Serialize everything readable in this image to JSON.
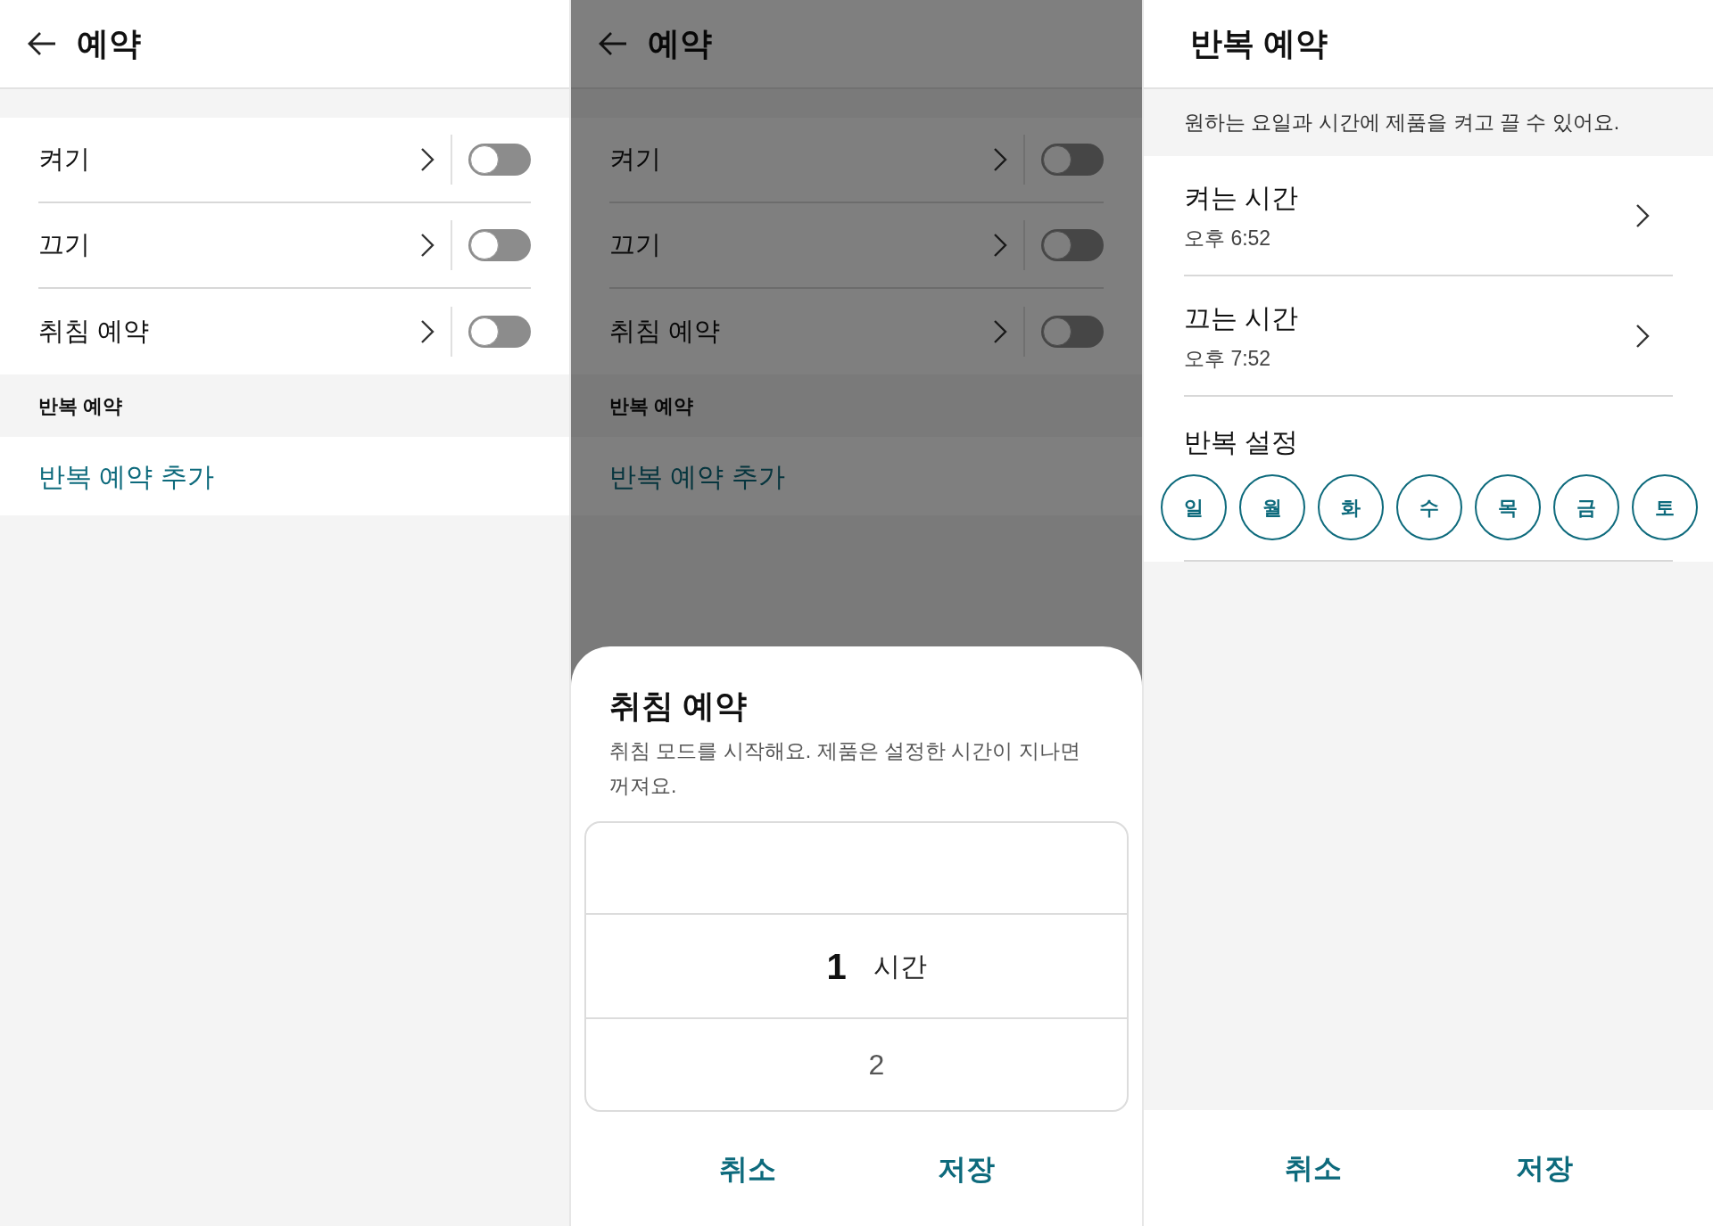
{
  "schedule_screen": {
    "title": "예약",
    "items": [
      {
        "label": "켜기",
        "on": false
      },
      {
        "label": "끄기",
        "on": false
      },
      {
        "label": "취침 예약",
        "on": false
      }
    ],
    "section_title": "반복 예약",
    "add_link": "반복 예약 추가"
  },
  "sleep_screen": {
    "title": "예약",
    "items": [
      {
        "label": "켜기",
        "on": false
      },
      {
        "label": "끄기",
        "on": false
      },
      {
        "label": "취침 예약",
        "on": false
      }
    ],
    "section_title": "반복 예약",
    "add_link": "반복 예약 추가",
    "sheet": {
      "title": "취침 예약",
      "description": "취침 모드를 시작해요. 제품은 설정한 시간이 지나면 꺼져요.",
      "picker": [
        {
          "value": "1",
          "unit": "시간",
          "selected": true
        },
        {
          "value": "2",
          "selected": false
        }
      ],
      "buttons": [
        "취소",
        "저장"
      ]
    }
  },
  "repeat_screen": {
    "title": "반복 예약",
    "description": "원하는 요일과 시간에 제품을 켜고 끌 수 있어요.",
    "times": [
      {
        "label": "켜는 시간",
        "value": "오후 6:52"
      },
      {
        "label": "끄는 시간",
        "value": "오후 7:52"
      }
    ],
    "repeat_title": "반복 설정",
    "days": [
      {
        "label": "일",
        "selected": false
      },
      {
        "label": "월",
        "selected": false
      },
      {
        "label": "화",
        "selected": false
      },
      {
        "label": "수",
        "selected": false
      },
      {
        "label": "목",
        "selected": false
      },
      {
        "label": "금",
        "selected": false
      },
      {
        "label": "토",
        "selected": false
      }
    ],
    "buttons": [
      "취소",
      "저장"
    ]
  }
}
